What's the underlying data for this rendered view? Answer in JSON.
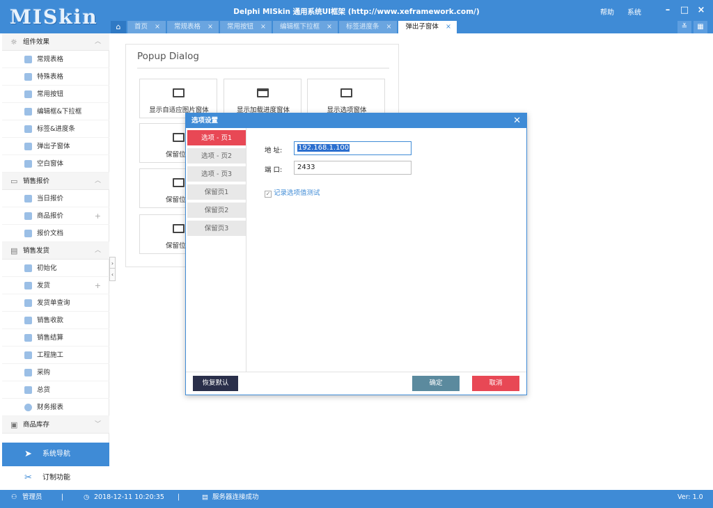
{
  "app": {
    "logo": "MISkin",
    "title": "Delphi MISkin 通用系统UI框架 (http://www.xeframework.com/)",
    "menu": {
      "help": "帮助",
      "system": "系统"
    }
  },
  "tabs": [
    {
      "label": "首页"
    },
    {
      "label": "常规表格"
    },
    {
      "label": "常用按钮"
    },
    {
      "label": "编辑框下拉框"
    },
    {
      "label": "标签进度条"
    },
    {
      "label": "弹出子窗体"
    }
  ],
  "sidebar": {
    "groups": [
      {
        "label": "组件效果",
        "items": [
          {
            "label": "常规表格"
          },
          {
            "label": "特殊表格"
          },
          {
            "label": "常用按钮"
          },
          {
            "label": "编辑框&下拉框"
          },
          {
            "label": "标签&进度条"
          },
          {
            "label": "弹出子窗体"
          },
          {
            "label": "空白窗体"
          }
        ]
      },
      {
        "label": "销售报价",
        "items": [
          {
            "label": "当日报价"
          },
          {
            "label": "商品报价"
          },
          {
            "label": "报价文档"
          }
        ]
      },
      {
        "label": "销售发货",
        "items": [
          {
            "label": "初始化"
          },
          {
            "label": "发货"
          },
          {
            "label": "发货单查询"
          },
          {
            "label": "销售收款"
          },
          {
            "label": "销售结算"
          },
          {
            "label": "工程施工"
          },
          {
            "label": "采购"
          },
          {
            "label": "总货"
          },
          {
            "label": "财务报表"
          }
        ]
      },
      {
        "label": "商品库存",
        "items": []
      }
    ],
    "nav_system": "系统导航",
    "nav_custom": "订制功能"
  },
  "panel": {
    "title": "Popup Dialog",
    "cards": [
      {
        "label": "显示自适应图片窗体"
      },
      {
        "label": "显示加载进度窗体"
      },
      {
        "label": "显示选项窗体"
      },
      {
        "label": "保留位置"
      },
      {
        "label": "保留位置"
      },
      {
        "label": "保留位置"
      }
    ]
  },
  "dialog": {
    "title": "选项设置",
    "tabs": [
      {
        "label": "选项 - 页1"
      },
      {
        "label": "选项 - 页2"
      },
      {
        "label": "选项 - 页3"
      },
      {
        "label": "保留页1"
      },
      {
        "label": "保留页2"
      },
      {
        "label": "保留页3"
      }
    ],
    "address_label": "地 址:",
    "address_value": "192.168.1.100",
    "port_label": "端 口:",
    "port_value": "2433",
    "checkbox_label": "记录选项值测试",
    "restore_button": "恢复默认",
    "ok_button": "确定",
    "cancel_button": "取消"
  },
  "status": {
    "user": "管理员",
    "datetime": "2018-12-11 10:20:35",
    "message": "服务器连接成功",
    "version": "Ver: 1.0"
  },
  "colors": {
    "primary": "#3f8bd6",
    "active_tab_red": "#e84855",
    "dark_button": "#2a2f4a",
    "ok_button": "#5b8a9e"
  }
}
